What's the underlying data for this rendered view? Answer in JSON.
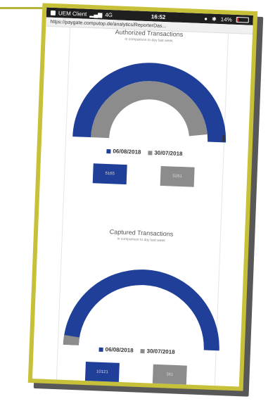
{
  "status_bar": {
    "carrier": "UEM Client",
    "network": "4G",
    "time": "16:52",
    "battery": "14%"
  },
  "url": "https://paygate.computop.de/analytics/ReporterDas...",
  "authorized": {
    "title": "Authorized Transactions",
    "subtitle": "in comparison to day last week",
    "legend": [
      {
        "label": "06/08/2018",
        "color": "#1f3f99"
      },
      {
        "label": "30/07/2018",
        "color": "#8c8c8c"
      }
    ],
    "buttons": [
      {
        "label": "5165",
        "color": "#1f3f99"
      },
      {
        "label": "5261",
        "color": "#8c8c8c"
      }
    ],
    "gauge": {
      "current_fraction": 1.0,
      "previous_fraction": 0.96
    }
  },
  "captured": {
    "title": "Captured Transactions",
    "subtitle": "in comparison to day last week",
    "legend": [
      {
        "label": "06/08/2018",
        "color": "#1f3f99"
      },
      {
        "label": "30/07/2018",
        "color": "#8c8c8c"
      }
    ],
    "buttons": [
      {
        "label": "10121",
        "color": "#1f3f99"
      },
      {
        "label": "361",
        "color": "#8c8c8c"
      }
    ],
    "gauge": {
      "current_fraction": 1.0,
      "previous_fraction": 0.04
    }
  }
}
